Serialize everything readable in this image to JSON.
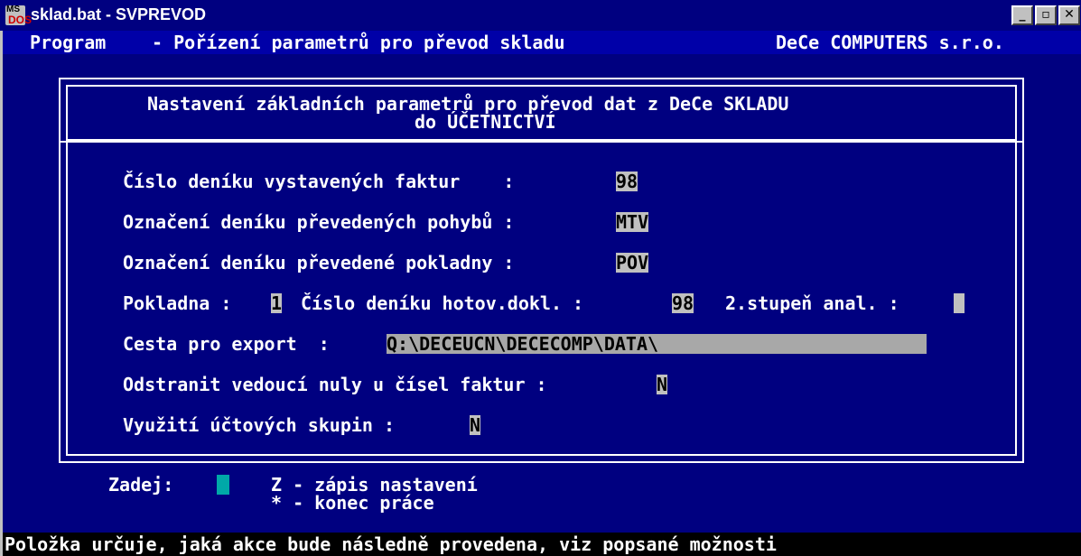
{
  "window": {
    "icon_ms": "MS",
    "icon_dos": "DOS",
    "title": "sklad.bat - SVPREVOD",
    "minimize_glyph": "_",
    "maximize_glyph": "▫",
    "close_glyph": "✕"
  },
  "menubar": {
    "left": "Program",
    "center": "- Pořízení parametrů pro převod skladu",
    "right": "DeCe COMPUTERS s.r.o."
  },
  "dialog": {
    "header_line1": "Nastavení základních parametrů pro převod dat z DeCe SKLADU",
    "header_line2": "do ÚČETNICTVÍ",
    "fields": {
      "invoice_journal_label": "Číslo deníku vystavených faktur    :",
      "invoice_journal_value": "98",
      "movements_journal_label": "Označení deníku převedených pohybů :",
      "movements_journal_value": "MTV",
      "cash_journal_label": "Označení deníku převedené pokladny :",
      "cash_journal_value": "POV",
      "cashbox_label": "Pokladna :",
      "cashbox_value": "1",
      "cash_doc_journal_label": "Číslo deníku hotov.dokl. :",
      "cash_doc_journal_value": "98",
      "analytic_level_label": "2.stupeň anal. :",
      "analytic_level_value": "",
      "export_path_label": "Cesta pro export  :",
      "export_path_value": "Q:\\DECEUCN\\DECECOMP\\DATA\\",
      "leading_zeros_label": "Odstranit vedoucí nuly u čísel faktur :",
      "leading_zeros_value": "N",
      "account_groups_label": "Využití účtových skupin :",
      "account_groups_value": "N"
    }
  },
  "prompt": {
    "label": "Zadej:",
    "option1": "Z - zápis nastavení",
    "option2": "* - konec práce"
  },
  "status": {
    "text": "Položka určuje, jaká akce bude následně provedena, viz popsané možnosti"
  },
  "colors": {
    "dos_background": "#000080",
    "field_background": "#c0c0c0",
    "cursor": "#00a8a8",
    "status_background": "#000000"
  }
}
